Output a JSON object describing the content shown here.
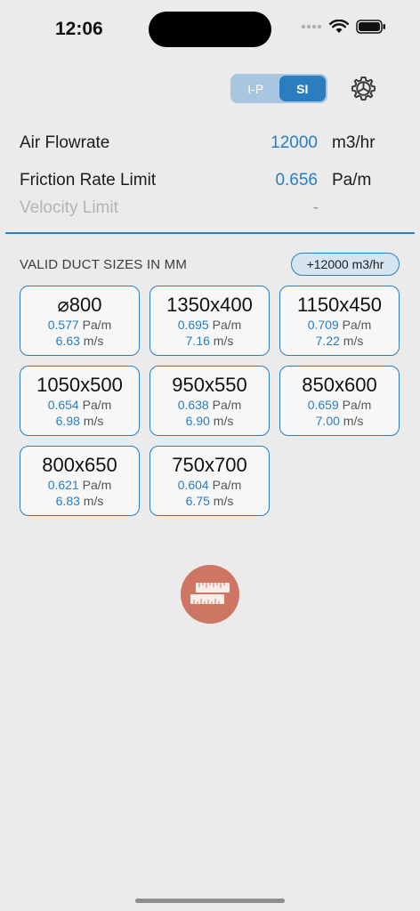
{
  "status": {
    "time": "12:06"
  },
  "unit_toggle": {
    "options": [
      "I-P",
      "SI"
    ],
    "selected": "SI"
  },
  "inputs": {
    "air_flowrate": {
      "label": "Air Flowrate",
      "value": "12000",
      "unit": "m3/hr"
    },
    "friction_rate": {
      "label": "Friction Rate Limit",
      "value": "0.656",
      "unit": "Pa/m"
    },
    "velocity_limit": {
      "label": "Velocity Limit",
      "value": "-"
    }
  },
  "results": {
    "title": "VALID DUCT SIZES IN MM",
    "flow_badge": "+12000 m3/hr",
    "friction_unit": "Pa/m",
    "velocity_unit": "m/s",
    "cards": [
      {
        "size": "⌀800",
        "friction": "0.577",
        "velocity": "6.63"
      },
      {
        "size": "1350x400",
        "friction": "0.695",
        "velocity": "7.16"
      },
      {
        "size": "1150x450",
        "friction": "0.709",
        "velocity": "7.22"
      },
      {
        "size": "1050x500",
        "friction": "0.654",
        "velocity": "6.98"
      },
      {
        "size": "950x550",
        "friction": "0.638",
        "velocity": "6.90"
      },
      {
        "size": "850x600",
        "friction": "0.659",
        "velocity": "7.00"
      },
      {
        "size": "800x650",
        "friction": "0.621",
        "velocity": "6.83"
      },
      {
        "size": "750x700",
        "friction": "0.604",
        "velocity": "6.75"
      }
    ]
  },
  "colors": {
    "accent": "#2a7ec0",
    "fab": "#cf7563",
    "background": "#ebebeb"
  },
  "icons": {
    "settings": "gear-icon",
    "fab": "ruler-icon"
  }
}
